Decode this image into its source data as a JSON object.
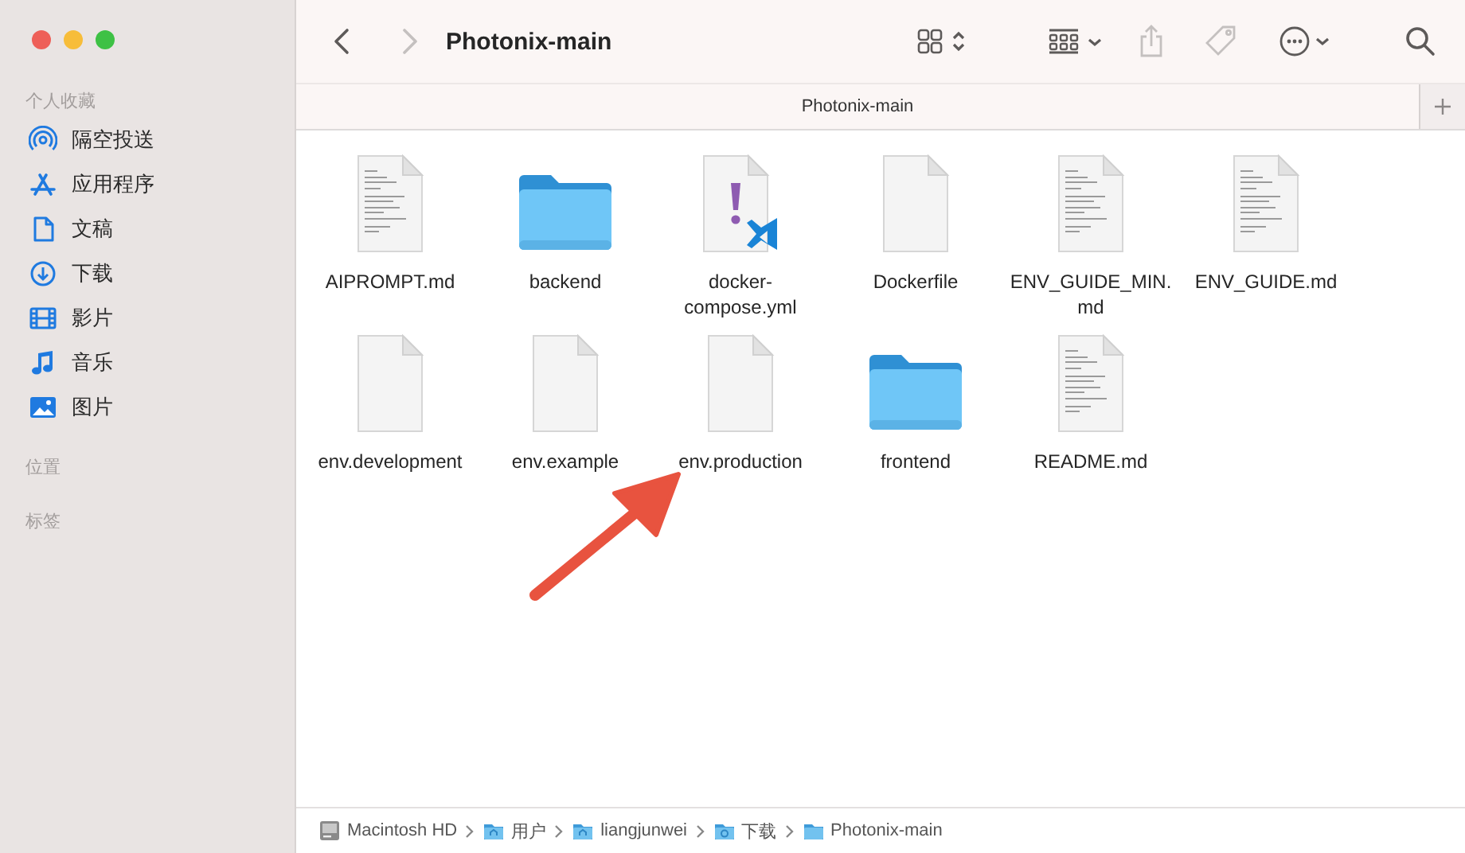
{
  "window": {
    "title": "Photonix-main"
  },
  "toolbar": {
    "buttons": [
      {
        "kind": "back",
        "disabled": false
      },
      {
        "kind": "forward",
        "disabled": true
      },
      {
        "kind": "title"
      },
      {
        "kind": "icon-view",
        "disabled": false
      },
      {
        "kind": "group",
        "disabled": false
      },
      {
        "kind": "share",
        "disabled": true
      },
      {
        "kind": "tag",
        "disabled": true
      },
      {
        "kind": "more",
        "disabled": false
      },
      {
        "kind": "search",
        "disabled": false
      }
    ]
  },
  "tab": {
    "label": "Photonix-main",
    "selected": true
  },
  "sidebar": {
    "sections": [
      {
        "heading": "个人收藏",
        "items": [
          {
            "label": "隔空投送",
            "kind": "airdrop"
          },
          {
            "label": "应用程序",
            "kind": "apps"
          },
          {
            "label": "文稿",
            "kind": "doc"
          },
          {
            "label": "下载",
            "kind": "download"
          },
          {
            "label": "影片",
            "kind": "movie"
          },
          {
            "label": "音乐",
            "kind": "music"
          },
          {
            "label": "图片",
            "kind": "picture"
          }
        ]
      },
      {
        "heading": "位置"
      },
      {
        "heading": "标签"
      }
    ]
  },
  "files": [
    {
      "name": "AIPROMPT.md",
      "kind": "text-doc"
    },
    {
      "name": "backend",
      "kind": "folder"
    },
    {
      "name": "docker-compose.yml",
      "kind": "yaml"
    },
    {
      "name": "Dockerfile",
      "kind": "blank"
    },
    {
      "name": "ENV_GUIDE_MIN.md",
      "kind": "text-doc"
    },
    {
      "name": "ENV_GUIDE.md",
      "kind": "text-doc"
    },
    {
      "name": "env.development",
      "kind": "blank"
    },
    {
      "name": "env.example",
      "kind": "blank"
    },
    {
      "name": "env.production",
      "kind": "blank"
    },
    {
      "name": "frontend",
      "kind": "folder"
    },
    {
      "name": "README.md",
      "kind": "text-doc"
    }
  ],
  "path_bar": [
    {
      "label": "Macintosh HD",
      "kind": "disk"
    },
    {
      "label": "用户",
      "kind": "home-folder"
    },
    {
      "label": "liangjunwei",
      "kind": "home-folder"
    },
    {
      "label": "下载",
      "kind": "download-folder"
    },
    {
      "label": "Photonix-main",
      "kind": "folder"
    }
  ],
  "annotation": {
    "kind": "arrow"
  }
}
